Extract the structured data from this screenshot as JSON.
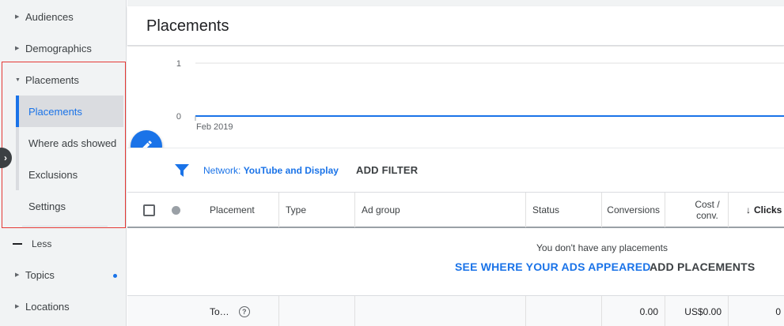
{
  "sidebar": {
    "items": [
      {
        "label": "Audiences",
        "caret": "▶"
      },
      {
        "label": "Demographics",
        "caret": "▶"
      },
      {
        "label": "Placements",
        "caret": "▼"
      }
    ],
    "sub_items": [
      {
        "label": "Placements"
      },
      {
        "label": "Where ads showed"
      },
      {
        "label": "Exclusions"
      },
      {
        "label": "Settings"
      }
    ],
    "less_label": "Less",
    "more_items": [
      {
        "label": "Topics",
        "caret": "▶"
      },
      {
        "label": "Locations",
        "caret": "▶"
      }
    ],
    "collapse_glyph": "›"
  },
  "header": {
    "title": "Placements"
  },
  "chart_data": {
    "type": "line",
    "x": [
      "Feb 2019"
    ],
    "series": [
      {
        "values": [
          0
        ]
      }
    ],
    "y_ticks": [
      "1",
      "0"
    ],
    "ylim": [
      0,
      1
    ],
    "x_tick_label": "Feb 2019",
    "grid": true,
    "line_color": "#1a73e8"
  },
  "filter": {
    "label": "Network: ",
    "value": "YouTube and Display",
    "add_filter": "ADD FILTER"
  },
  "table": {
    "columns": [
      {
        "label": "Placement"
      },
      {
        "label": "Type"
      },
      {
        "label": "Ad group"
      },
      {
        "label": "Status"
      },
      {
        "label": "Conversions"
      },
      {
        "label": "Cost / conv."
      },
      {
        "label": "Clicks",
        "sort_glyph": "↓"
      }
    ],
    "empty_message": "You don't have any placements",
    "see_where": "SEE WHERE YOUR ADS APPEARED",
    "add_placements": "ADD PLACEMENTS",
    "total": {
      "label": "To…",
      "help_glyph": "?",
      "conversions": "0.00",
      "cost_conv": "US$0.00",
      "clicks": "0"
    }
  },
  "colors": {
    "accent": "#1a73e8",
    "highlight_box": "#e53935"
  }
}
